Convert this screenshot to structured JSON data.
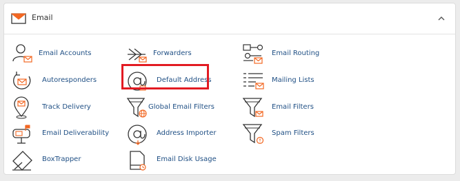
{
  "section": {
    "title": "Email"
  },
  "items": {
    "email_accounts": "Email Accounts",
    "forwarders": "Forwarders",
    "email_routing": "Email Routing",
    "autoresponders": "Autoresponders",
    "default_address": "Default Address",
    "mailing_lists": "Mailing Lists",
    "track_delivery": "Track Delivery",
    "global_email_filters": "Global Email Filters",
    "email_filters": "Email Filters",
    "email_deliverability": "Email Deliverability",
    "address_importer": "Address Importer",
    "spam_filters": "Spam Filters",
    "boxtrapper": "BoxTrapper",
    "email_disk_usage": "Email Disk Usage"
  },
  "colors": {
    "accent": "#f26722",
    "icon": "#333333",
    "link": "#1f4f84",
    "highlight": "#e21a22"
  },
  "icons": {
    "header": "envelope-icon",
    "collapse": "chevron-up-icon"
  }
}
